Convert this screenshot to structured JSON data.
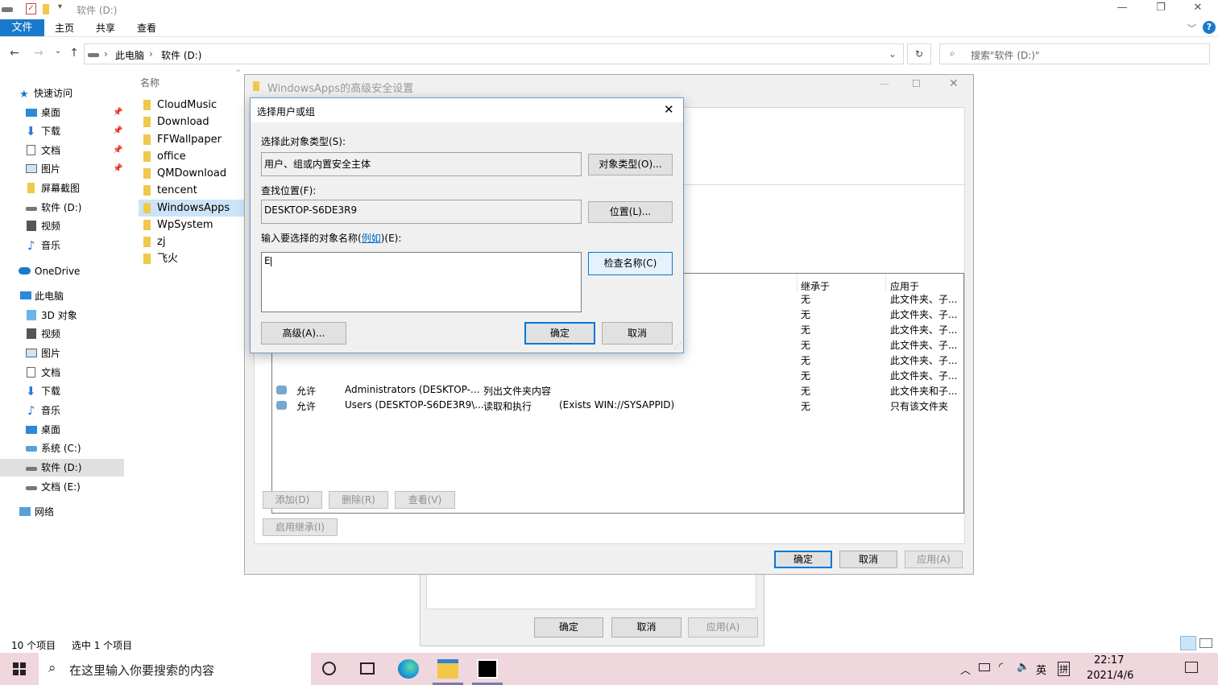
{
  "window": {
    "title": "软件 (D:)",
    "controls": [
      "—",
      "❐",
      "✕"
    ]
  },
  "ribbon": {
    "tabs": [
      "文件",
      "主页",
      "共享",
      "查看"
    ]
  },
  "address": {
    "crumbs": [
      "此电脑",
      "软件 (D:)"
    ],
    "search_placeholder": "搜索\"软件 (D:)\""
  },
  "navpane": {
    "quick_access": "快速访问",
    "quick_items": [
      "桌面",
      "下载",
      "文档",
      "图片",
      "屏幕截图",
      "软件 (D:)",
      "视频",
      "音乐"
    ],
    "onedrive": "OneDrive",
    "this_pc": "此电脑",
    "pc_items": [
      "3D 对象",
      "视频",
      "图片",
      "文档",
      "下载",
      "音乐",
      "桌面",
      "系统 (C:)",
      "软件 (D:)",
      "文档 (E:)"
    ],
    "network": "网络"
  },
  "filelist": {
    "column": "名称",
    "items": [
      "CloudMusic",
      "Download",
      "FFWallpaper",
      "office",
      "QMDownload",
      "tencent",
      "WindowsApps",
      "WpSystem",
      "zj",
      "飞火"
    ]
  },
  "status": {
    "count": "10 个项目",
    "selected": "选中 1 个项目"
  },
  "advanced_dialog": {
    "title": "WindowsApps的高级安全设置",
    "headers": {
      "inherited": "继承于",
      "applies": "应用于"
    },
    "rows": [
      {
        "inherited": "无",
        "applies": "此文件夹、子..."
      },
      {
        "inherited": "无",
        "applies": "此文件夹、子..."
      },
      {
        "inherited": "无",
        "applies": "此文件夹、子..."
      },
      {
        "inherited": "无",
        "applies": "此文件夹、子..."
      },
      {
        "inherited": "无",
        "applies": "此文件夹、子..."
      },
      {
        "inherited": "无",
        "applies": "此文件夹、子..."
      },
      {
        "type": "允许",
        "principal": "Administrators (DESKTOP-...",
        "access": "列出文件夹内容",
        "condition": "",
        "inherited": "无",
        "applies": "此文件夹和子..."
      },
      {
        "type": "允许",
        "principal": "Users (DESKTOP-S6DE3R9\\...",
        "access": "读取和执行",
        "condition": "(Exists WIN://SYSAPPID)",
        "inherited": "无",
        "applies": "只有该文件夹"
      }
    ],
    "buttons": {
      "add": "添加(D)",
      "remove": "删除(R)",
      "view": "查看(V)",
      "enable_inherit": "启用继承(I)",
      "ok": "确定",
      "cancel": "取消",
      "apply": "应用(A)"
    }
  },
  "back_dialog": {
    "buttons": {
      "ok": "确定",
      "cancel": "取消",
      "apply": "应用(A)"
    }
  },
  "select_dialog": {
    "title": "选择用户或组",
    "object_type_label": "选择此对象类型(S):",
    "object_type_value": "用户、组或内置安全主体",
    "object_type_btn": "对象类型(O)...",
    "location_label": "查找位置(F):",
    "location_value": "DESKTOP-S6DE3R9",
    "location_btn": "位置(L)...",
    "enter_label_pre": "输入要选择的对象名称(",
    "enter_label_link": "例如",
    "enter_label_post": ")(E):",
    "enter_value": "E",
    "check_btn": "检查名称(C)",
    "advanced_btn": "高级(A)...",
    "ok_btn": "确定",
    "cancel_btn": "取消"
  },
  "taskbar": {
    "search_placeholder": "在这里输入你要搜索的内容",
    "time": "22:17",
    "date": "2021/4/6",
    "ime": "英",
    "ime2": "拼"
  }
}
